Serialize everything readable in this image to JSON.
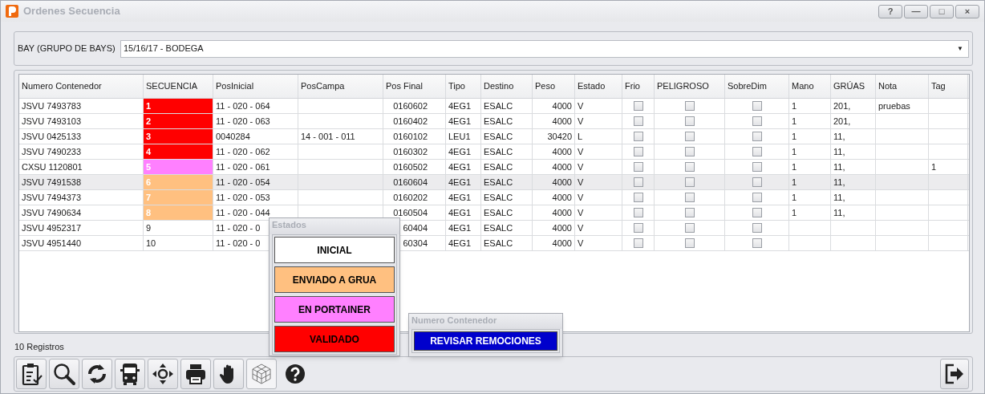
{
  "window": {
    "title": "Ordenes Secuencia",
    "buttons": [
      "?",
      "—",
      "□",
      "×"
    ]
  },
  "bay": {
    "label": "BAY (GRUPO DE BAYS)",
    "value": "15/16/17 - BODEGA",
    "arrow": "▼"
  },
  "table": {
    "columns": [
      "Numero Contenedor",
      "SECUENCIA",
      "PosInicial",
      "PosCampa",
      "Pos Final",
      "Tipo",
      "Destino",
      "Peso",
      "Estado",
      "Frio",
      "PELIGROSO",
      "SobreDim",
      "Mano",
      "GRÚAS",
      "Nota",
      "Tag"
    ],
    "rows": [
      {
        "selected": false,
        "color": "#ff0000",
        "contenedor": "JSVU 7493783",
        "secuencia": "1",
        "pos_inicial": "11 - 020 - 064",
        "pos_final": "0160602",
        "tipo": "4EG1",
        "destino": "ESALC",
        "peso": "4000",
        "estado": "V",
        "frio": false,
        "peligroso": false,
        "sobredim": false,
        "mano": "1",
        "gruas": "201,",
        "nota": "pruebas"
      },
      {
        "selected": false,
        "color": "#ff0000",
        "contenedor": "JSVU 7493103",
        "secuencia": "2",
        "pos_inicial": "11 - 020 - 063",
        "pos_final": "0160402",
        "tipo": "4EG1",
        "destino": "ESALC",
        "peso": "4000",
        "estado": "V",
        "frio": false,
        "peligroso": false,
        "sobredim": false,
        "mano": "1",
        "gruas": "201,"
      },
      {
        "selected": false,
        "color": "#ff0000",
        "contenedor": "JSVU 0425133",
        "secuencia": "3",
        "pos_inicial": "0040284",
        "pos_campa": "14 - 001 - 011",
        "pos_final": "0160102",
        "tipo": "LEU1",
        "destino": "ESALC",
        "peso": "30420",
        "estado": "L",
        "frio": false,
        "peligroso": false,
        "sobredim": false,
        "mano": "1",
        "gruas": "11,"
      },
      {
        "selected": false,
        "color": "#ff0000",
        "contenedor": "JSVU 7490233",
        "secuencia": "4",
        "pos_inicial": "11 - 020 - 062",
        "pos_final": "0160302",
        "tipo": "4EG1",
        "destino": "ESALC",
        "peso": "4000",
        "estado": "V",
        "frio": false,
        "peligroso": false,
        "sobredim": false,
        "mano": "1",
        "gruas": "11,"
      },
      {
        "selected": false,
        "color": "#ff80ff",
        "contenedor": "CXSU 1120801",
        "secuencia": "5",
        "pos_inicial": "11 - 020 - 061",
        "pos_final": "0160502",
        "tipo": "4EG1",
        "destino": "ESALC",
        "peso": "4000",
        "estado": "V",
        "frio": false,
        "peligroso": false,
        "sobredim": false,
        "mano": "1",
        "gruas": "11,",
        "tag": "1"
      },
      {
        "selected": true,
        "color": "#ffc080",
        "contenedor": "JSVU 7491538",
        "secuencia": "6",
        "pos_inicial": "11 - 020 - 054",
        "pos_final": "0160604",
        "tipo": "4EG1",
        "destino": "ESALC",
        "peso": "4000",
        "estado": "V",
        "frio": false,
        "peligroso": false,
        "sobredim": false,
        "mano": "1",
        "gruas": "11,"
      },
      {
        "selected": false,
        "color": "#ffc080",
        "contenedor": "JSVU 7494373",
        "secuencia": "7",
        "pos_inicial": "11 - 020 - 053",
        "pos_final": "0160202",
        "tipo": "4EG1",
        "destino": "ESALC",
        "peso": "4000",
        "estado": "V",
        "frio": false,
        "peligroso": false,
        "sobredim": false,
        "mano": "1",
        "gruas": "11,"
      },
      {
        "selected": false,
        "color": "#ffc080",
        "contenedor": "JSVU 7490634",
        "secuencia": "8",
        "pos_inicial": "11 - 020 - 044",
        "pos_final": "0160504",
        "tipo": "4EG1",
        "destino": "ESALC",
        "peso": "4000",
        "estado": "V",
        "frio": false,
        "peligroso": false,
        "sobredim": false,
        "mano": "1",
        "gruas": "11,"
      },
      {
        "selected": false,
        "contenedor": "JSVU 4952317",
        "secuencia": "9",
        "pos_inicial": "11 - 020 - 0",
        "pos_final": "60404",
        "tipo": "4EG1",
        "destino": "ESALC",
        "peso": "4000",
        "estado": "V",
        "frio": false,
        "peligroso": false,
        "sobredim": false
      },
      {
        "selected": false,
        "contenedor": "JSVU 4951440",
        "secuencia": "10",
        "pos_inicial": "11 - 020 - 0",
        "pos_final": "60304",
        "tipo": "4EG1",
        "destino": "ESALC",
        "peso": "4000",
        "estado": "V",
        "frio": false,
        "peligroso": false,
        "sobredim": false
      }
    ]
  },
  "record_count": "10 Registros",
  "toolbar": [
    {
      "kind": "clipboard"
    },
    {
      "kind": "search"
    },
    {
      "kind": "refresh"
    },
    {
      "kind": "truck"
    },
    {
      "kind": "move"
    },
    {
      "kind": "print"
    },
    {
      "kind": "hand"
    },
    {
      "kind": "cube"
    },
    {
      "kind": "help"
    }
  ],
  "estados_popup": {
    "title": "Estados",
    "buttons": [
      {
        "label": "INICIAL",
        "color": "#ffffff"
      },
      {
        "label": "ENVIADO A GRUA",
        "color": "#ffc080"
      },
      {
        "label": "EN PORTAINER",
        "color": "#ff80ff"
      },
      {
        "label": "VALIDADO",
        "color": "#ff0000"
      }
    ]
  },
  "contenedor_popup": {
    "title": "Numero Contenedor",
    "button": "REVISAR REMOCIONES"
  }
}
